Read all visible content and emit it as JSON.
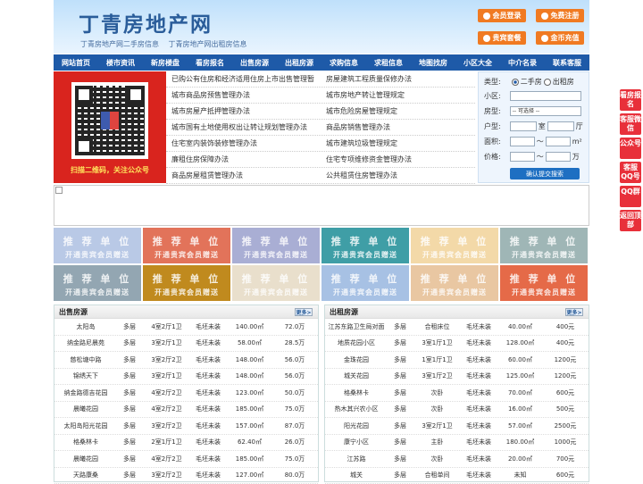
{
  "header": {
    "logo": "丁青房地产网",
    "sub1": "丁青房地产网二手房信息",
    "sub2": "丁青房地产网出租房信息",
    "buttons": [
      "会员登录",
      "免费注册",
      "贵宾套餐",
      "金币充值"
    ]
  },
  "nav": [
    "网站首页",
    "楼市资讯",
    "新房楼盘",
    "看房报名",
    "出售房源",
    "出租房源",
    "求购信息",
    "求租信息",
    "地图找房",
    "小区大全",
    "中介名录",
    "联系客服"
  ],
  "qr": {
    "caption": "扫描二维码，关注公众号"
  },
  "links": [
    [
      "已购公有住房和经济适用住房上市出售管理暂",
      "房屋建筑工程质量保修办法"
    ],
    [
      "城市商品房预售管理办法",
      "城市房地产转让管理规定"
    ],
    [
      "城市房屋产抵押管理办法",
      "城市危险房屋管理规定"
    ],
    [
      "城市国有土地使用权出让转让规划管理办法",
      "商品房销售管理办法"
    ],
    [
      "住宅室内装饰装修管理办法",
      "城市建筑垃圾管理规定"
    ],
    [
      "廉租住房保障办法",
      "住宅专项维修资金管理办法"
    ],
    [
      "商品房屋租赁管理办法",
      "公共租赁住房管理办法"
    ]
  ],
  "search": {
    "type_label": "类型:",
    "opt1": "二手房",
    "opt2": "出租房",
    "area_label": "小区:",
    "htype_label": "房型:",
    "htype_value": "-- 可选择 --",
    "layout_label": "户型:",
    "room": "室",
    "hall": "厅",
    "size_label": "面积:",
    "size_unit": "m²",
    "tilde": "～",
    "price_label": "价格:",
    "price_unit": "万",
    "submit": "确认提交搜索"
  },
  "tiles": {
    "t1": "推 荐 单 位",
    "t2": "开通贵宾会员赠送"
  },
  "sale": {
    "title": "出售房源",
    "more": "更多>",
    "rows": [
      [
        "太阳岛",
        "多层",
        "4室2厅1卫",
        "毛坯未装",
        "140.00㎡",
        "72.0万"
      ],
      [
        "纳金路尼晨苑",
        "多层",
        "3室2厅1卫",
        "毛坯未装",
        "58.00㎡",
        "28.5万"
      ],
      [
        "慈松塘中路",
        "多层",
        "3室2厅2卫",
        "毛坯未装",
        "148.00㎡",
        "56.0万"
      ],
      [
        "锦绣天下",
        "多层",
        "3室2厅1卫",
        "毛坯未装",
        "148.00㎡",
        "56.0万"
      ],
      [
        "纳金路德吉花园",
        "多层",
        "4室2厅2卫",
        "毛坯未装",
        "123.00㎡",
        "50.0万"
      ],
      [
        "晨曦花园",
        "多层",
        "4室2厅2卫",
        "毛坯未装",
        "185.00㎡",
        "75.0万"
      ],
      [
        "太阳岛阳光花园",
        "多层",
        "3室2厅2卫",
        "毛坯未装",
        "157.00㎡",
        "87.0万"
      ],
      [
        "格桑林卡",
        "多层",
        "2室1厅1卫",
        "毛坯未装",
        "62.40㎡",
        "26.0万"
      ],
      [
        "晨曦花园",
        "多层",
        "4室2厅2卫",
        "毛坯未装",
        "185.00㎡",
        "75.0万"
      ],
      [
        "天路康桑",
        "多层",
        "3室2厅2卫",
        "毛坯未装",
        "127.00㎡",
        "80.0万"
      ]
    ]
  },
  "rent": {
    "title": "出租房源",
    "more": "更多>",
    "rows": [
      [
        "江苏东路卫生局对面",
        "多层",
        "合租床位",
        "毛坯未装",
        "40.00㎡",
        "400元"
      ],
      [
        "地质花园小区",
        "多层",
        "3室1厅1卫",
        "毛坯未装",
        "128.00㎡",
        "400元"
      ],
      [
        "金珠花园",
        "多层",
        "1室1厅1卫",
        "毛坯未装",
        "60.00㎡",
        "1200元"
      ],
      [
        "城关花园",
        "多层",
        "3室1厅2卫",
        "毛坯未装",
        "125.00㎡",
        "1200元"
      ],
      [
        "格桑林卡",
        "多层",
        "次卧",
        "毛坯未装",
        "70.00㎡",
        "600元"
      ],
      [
        "热木其兴农小区",
        "多层",
        "次卧",
        "毛坯未装",
        "16.00㎡",
        "500元"
      ],
      [
        "阳光花园",
        "多层",
        "3室2厅1卫",
        "毛坯未装",
        "57.00㎡",
        "2500元"
      ],
      [
        "康宁小区",
        "多层",
        "主卧",
        "毛坯未装",
        "180.00㎡",
        "1000元"
      ],
      [
        "江苏路",
        "多层",
        "次卧",
        "毛坯未装",
        "20.00㎡",
        "700元"
      ],
      [
        "城关",
        "多层",
        "合租单间",
        "毛坯未装",
        "未知",
        "600元"
      ]
    ]
  },
  "side": [
    "看房报名",
    "客服微信",
    "公众号",
    "客服QQ号",
    "QQ群",
    "返回顶部"
  ]
}
